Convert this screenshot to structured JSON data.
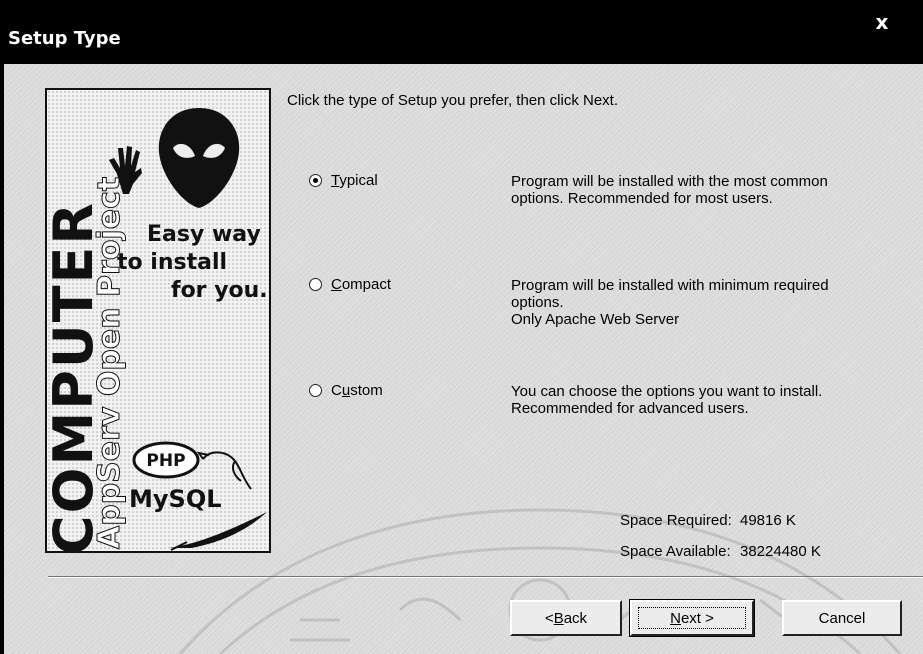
{
  "window": {
    "title": "Setup Type",
    "close_glyph": "x",
    "close_icon": "close-icon"
  },
  "banner": {
    "brand_big": "COMPUTER",
    "brand_small": "AppServ Open Project",
    "tagline_line1": "Easy way",
    "tagline_line2": "to install",
    "tagline_line3": "for you.",
    "php_logo_text": "PHP",
    "mysql_text": "MySQL",
    "icons": [
      "alien-head-icon",
      "hand-icon",
      "php-logo-icon",
      "dolphin-icon",
      "feather-icon"
    ]
  },
  "instructions": "Click the type of Setup you prefer, then click Next.",
  "options": [
    {
      "mnemonic": "T",
      "rest": "ypical",
      "selected": true,
      "desc_lines": [
        "Program will be installed with the most common",
        "options. Recommended for most users."
      ]
    },
    {
      "mnemonic": "C",
      "rest": "ompact",
      "selected": false,
      "desc_lines": [
        "Program will be installed with minimum required",
        "options.",
        "Only Apache Web Server"
      ]
    },
    {
      "prefix": "C",
      "mnemonic": "u",
      "rest": "stom",
      "selected": false,
      "desc_lines": [
        "You can choose the options you want to install.",
        "Recommended for advanced users."
      ]
    }
  ],
  "space": {
    "required_label": "Space Required:",
    "required_value": "49816 K",
    "available_label": "Space Available:",
    "available_value": "38224480 K"
  },
  "buttons": {
    "back_prefix": "< ",
    "back_mnemonic": "B",
    "back_rest": "ack",
    "next_mnemonic": "N",
    "next_rest": "ext >",
    "cancel": "Cancel"
  },
  "colors": {
    "title_bar": "#000000",
    "dialog_bg": "#e0e0e0"
  }
}
